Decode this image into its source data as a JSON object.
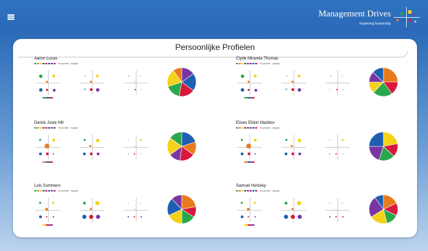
{
  "app": {
    "brand_title": "Management Drives",
    "brand_subtitle": "mastering leadership",
    "page_title": "Persoonlijke Profielen"
  },
  "colors": {
    "green": "#2aa84a",
    "orange": "#e87a1d",
    "yellow": "#f4d21a",
    "blue": "#1f5fb0",
    "red": "#d9183e",
    "purple": "#7a35a3",
    "light_blue": "#8fc2e6",
    "light_gray": "#cfcfcf"
  },
  "profiles": [
    {
      "name": "Aaron Lucas",
      "date": "15 juli 2015",
      "type": "Zakelijk",
      "pie": [
        {
          "color": "purple",
          "value": 15
        },
        {
          "color": "blue",
          "value": 20
        },
        {
          "color": "red",
          "value": 18
        },
        {
          "color": "green",
          "value": 17
        },
        {
          "color": "yellow",
          "value": 20
        },
        {
          "color": "orange",
          "value": 10
        }
      ]
    },
    {
      "name": "Clyde Miranda Thomas",
      "date": "15 juli 2015",
      "type": "Zakelijk",
      "pie": [
        {
          "color": "orange",
          "value": 25
        },
        {
          "color": "red",
          "value": 15
        },
        {
          "color": "green",
          "value": 22
        },
        {
          "color": "yellow",
          "value": 13
        },
        {
          "color": "purple",
          "value": 12
        },
        {
          "color": "blue",
          "value": 13
        }
      ]
    },
    {
      "name": "Derick Josie Hill",
      "date": "15 juli 2015",
      "type": "Zakelijk",
      "pie": [
        {
          "color": "blue",
          "value": 20
        },
        {
          "color": "orange",
          "value": 15
        },
        {
          "color": "red",
          "value": 17
        },
        {
          "color": "purple",
          "value": 13
        },
        {
          "color": "yellow",
          "value": 20
        },
        {
          "color": "green",
          "value": 15
        }
      ]
    },
    {
      "name": "Eliseo Eldon Maddox",
      "date": "15 juli 2015",
      "type": "Zakelijk",
      "pie": [
        {
          "color": "yellow",
          "value": 22
        },
        {
          "color": "red",
          "value": 15
        },
        {
          "color": "green",
          "value": 18
        },
        {
          "color": "purple",
          "value": 20
        },
        {
          "color": "blue",
          "value": 25
        }
      ]
    },
    {
      "name": "Lois Summers",
      "date": "15 juli 2015",
      "type": "Zakelijk",
      "pie": [
        {
          "color": "orange",
          "value": 22
        },
        {
          "color": "red",
          "value": 12
        },
        {
          "color": "green",
          "value": 16
        },
        {
          "color": "yellow",
          "value": 18
        },
        {
          "color": "blue",
          "value": 20
        },
        {
          "color": "purple",
          "value": 12
        }
      ]
    },
    {
      "name": "Samuel Hensley",
      "date": "15 juli 2015",
      "type": "Zakelijk",
      "pie": [
        {
          "color": "orange",
          "value": 18
        },
        {
          "color": "red",
          "value": 14
        },
        {
          "color": "green",
          "value": 14
        },
        {
          "color": "yellow",
          "value": 20
        },
        {
          "color": "purple",
          "value": 24
        },
        {
          "color": "blue",
          "value": 10
        }
      ]
    }
  ]
}
